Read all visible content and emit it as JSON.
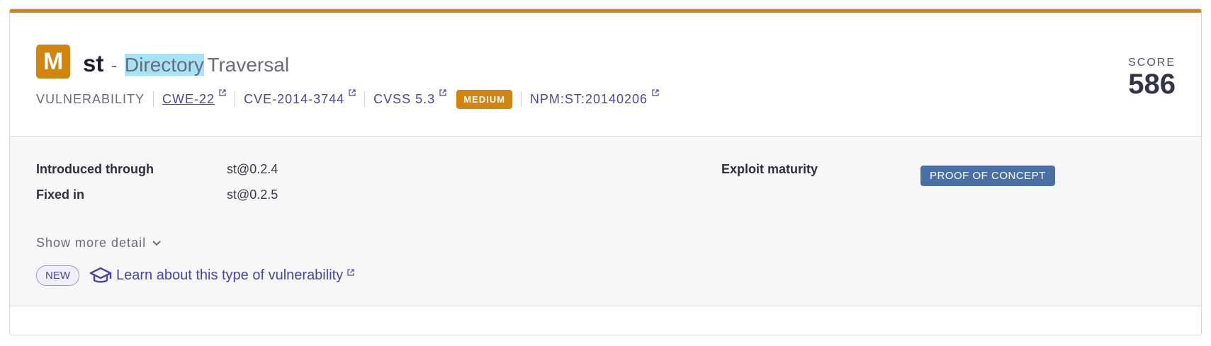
{
  "vuln": {
    "severity_letter": "M",
    "package": "st",
    "separator": "-",
    "title_part1": "Directory",
    "title_part2": "Traversal",
    "score_label": "SCORE",
    "score": "586"
  },
  "meta": {
    "type_label": "VULNERABILITY",
    "cwe": "CWE-22",
    "cve": "CVE-2014-3744",
    "cvss": "CVSS 5.3",
    "severity_pill": "MEDIUM",
    "npm_id": "NPM:ST:20140206"
  },
  "details": {
    "introduced_label": "Introduced through",
    "introduced_value": "st@0.2.4",
    "fixed_label": "Fixed in",
    "fixed_value": "st@0.2.5",
    "exploit_label": "Exploit maturity",
    "exploit_value": "PROOF OF CONCEPT",
    "show_more": "Show more detail"
  },
  "learn": {
    "new_badge": "NEW",
    "link_text": "Learn about this type of vulnerability"
  },
  "colors": {
    "severity_accent": "#d1840e",
    "link": "#4b45a1",
    "poc_badge": "#4a6fa5"
  },
  "icons": [
    "external-link-icon",
    "chevron-down-icon",
    "graduation-cap-icon"
  ]
}
